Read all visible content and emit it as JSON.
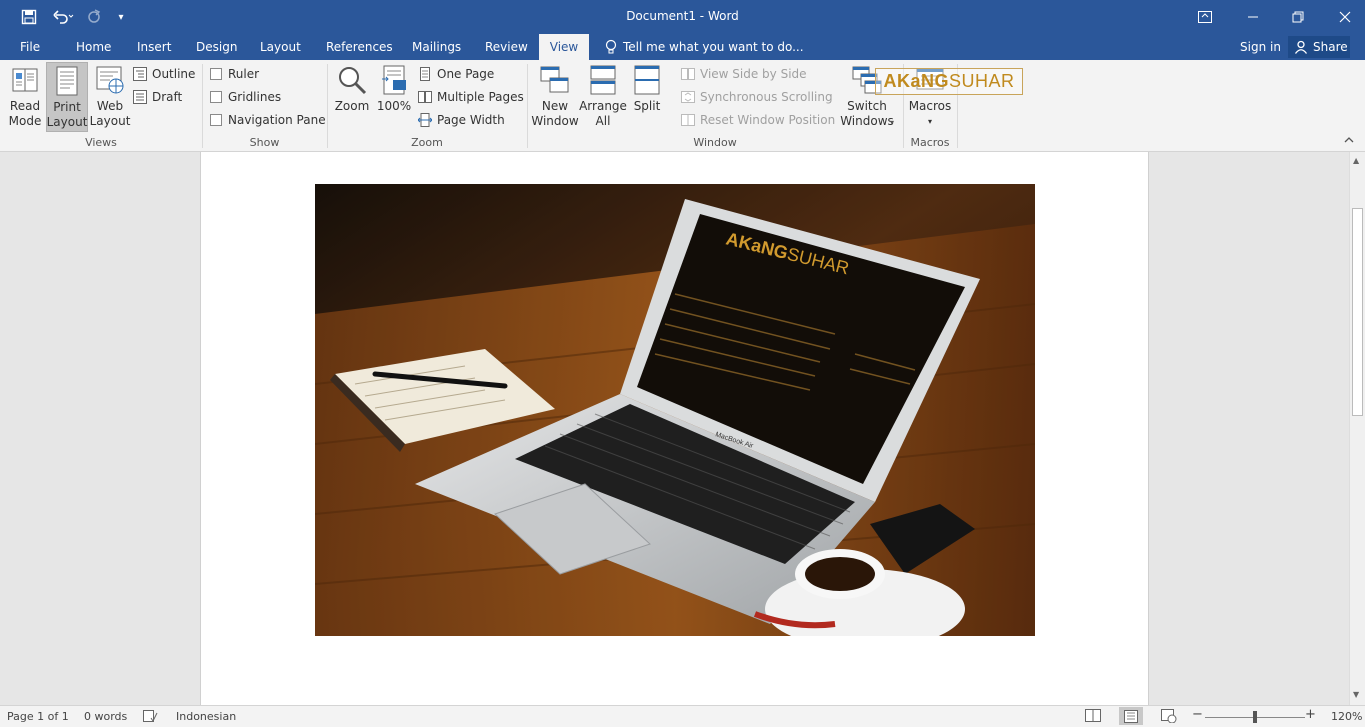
{
  "window": {
    "title": "Document1 - Word",
    "accent": "#2b579a"
  },
  "tabs": [
    {
      "label": "File"
    },
    {
      "label": "Home"
    },
    {
      "label": "Insert"
    },
    {
      "label": "Design"
    },
    {
      "label": "Layout"
    },
    {
      "label": "References"
    },
    {
      "label": "Mailings"
    },
    {
      "label": "Review"
    },
    {
      "label": "View"
    }
  ],
  "tell_me": "Tell me what you want to do...",
  "account": {
    "sign_in": "Sign in",
    "share": "Share"
  },
  "ribbon": {
    "views": {
      "read_mode": [
        "Read",
        "Mode"
      ],
      "print_layout": [
        "Print",
        "Layout"
      ],
      "web_layout": [
        "Web",
        "Layout"
      ],
      "outline": "Outline",
      "draft": "Draft",
      "group": "Views"
    },
    "show": {
      "ruler": "Ruler",
      "gridlines": "Gridlines",
      "navigation_pane": "Navigation Pane",
      "group": "Show"
    },
    "zoom": {
      "zoom": "Zoom",
      "hundred": "100%",
      "one_page": "One Page",
      "multiple_pages": "Multiple Pages",
      "page_width": "Page Width",
      "group": "Zoom"
    },
    "window": {
      "new_window": [
        "New",
        "Window"
      ],
      "arrange_all": [
        "Arrange",
        "All"
      ],
      "split": "Split",
      "view_side_by_side": "View Side by Side",
      "synchronous_scrolling": "Synchronous Scrolling",
      "reset_window_position": "Reset Window Position",
      "switch_windows": [
        "Switch",
        "Windows"
      ],
      "group": "Window"
    },
    "macros": {
      "macros": "Macros",
      "group": "Macros"
    }
  },
  "watermark": {
    "part1": "AKaNG",
    "part2": "SUHAR"
  },
  "document": {
    "image_icon": "laptop-photo",
    "laptop_brand": "MacBook Air",
    "screen_logo": {
      "part1": "AKaNG",
      "part2": "SUHAR"
    }
  },
  "status": {
    "page": "Page 1 of 1",
    "words": "0 words",
    "language": "Indonesian",
    "zoom": "120%"
  }
}
